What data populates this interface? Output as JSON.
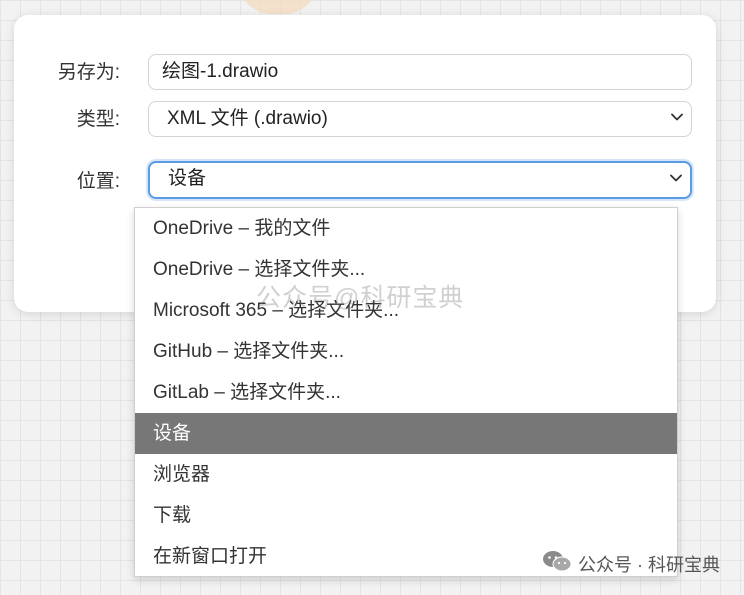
{
  "dialog": {
    "save_as_label": "另存为:",
    "filename": "绘图-1.drawio",
    "type_label": "类型:",
    "type_value": "XML 文件 (.drawio)",
    "location_label": "位置:",
    "location_value": "设备"
  },
  "dropdown": {
    "options": [
      "OneDrive  –  我的文件",
      "OneDrive  –  选择文件夹...",
      "Microsoft 365  –  选择文件夹...",
      "GitHub  –  选择文件夹...",
      "GitLab  –  选择文件夹...",
      "设备",
      "浏览器",
      "下载",
      "在新窗口打开"
    ],
    "selected_index": 5
  },
  "watermark": {
    "center_text": "公众号@科研宝典",
    "footer_text": "公众号 · 科研宝典"
  },
  "icons": {
    "chevron": "chevron-down-icon",
    "wechat": "wechat-icon"
  },
  "colors": {
    "focus_border": "#5b9be6",
    "selected_bg": "#777777"
  }
}
